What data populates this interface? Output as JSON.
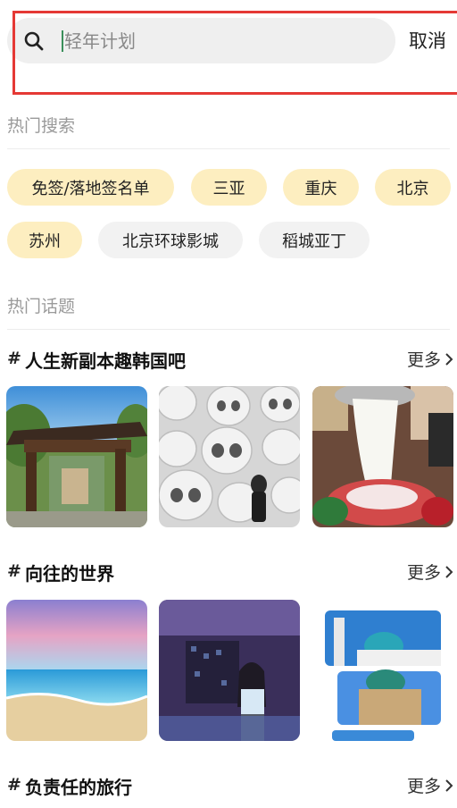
{
  "search": {
    "placeholder": "轻年计划",
    "cancel_label": "取消"
  },
  "hot_search": {
    "title": "热门搜索",
    "chips": [
      {
        "label": "免签/落地签名单",
        "style": "yellow"
      },
      {
        "label": "三亚",
        "style": "yellow"
      },
      {
        "label": "重庆",
        "style": "yellow"
      },
      {
        "label": "北京",
        "style": "yellow"
      },
      {
        "label": "苏州",
        "style": "yellow"
      },
      {
        "label": "北京环球影城",
        "style": "gray"
      },
      {
        "label": "稻城亚丁",
        "style": "gray"
      }
    ]
  },
  "hot_topics": {
    "title": "热门话题",
    "more_label": "更多",
    "topics": [
      {
        "title": "人生新副本趣韩国吧"
      },
      {
        "title": "向往的世界"
      },
      {
        "title": "负责任的旅行"
      }
    ]
  },
  "colors": {
    "accent_yellow": "#fdeec0",
    "chip_gray": "#f2f2f2",
    "highlight_red": "#e53935"
  },
  "icons": {
    "search": "search-icon",
    "more": "chevron-right-icon"
  }
}
